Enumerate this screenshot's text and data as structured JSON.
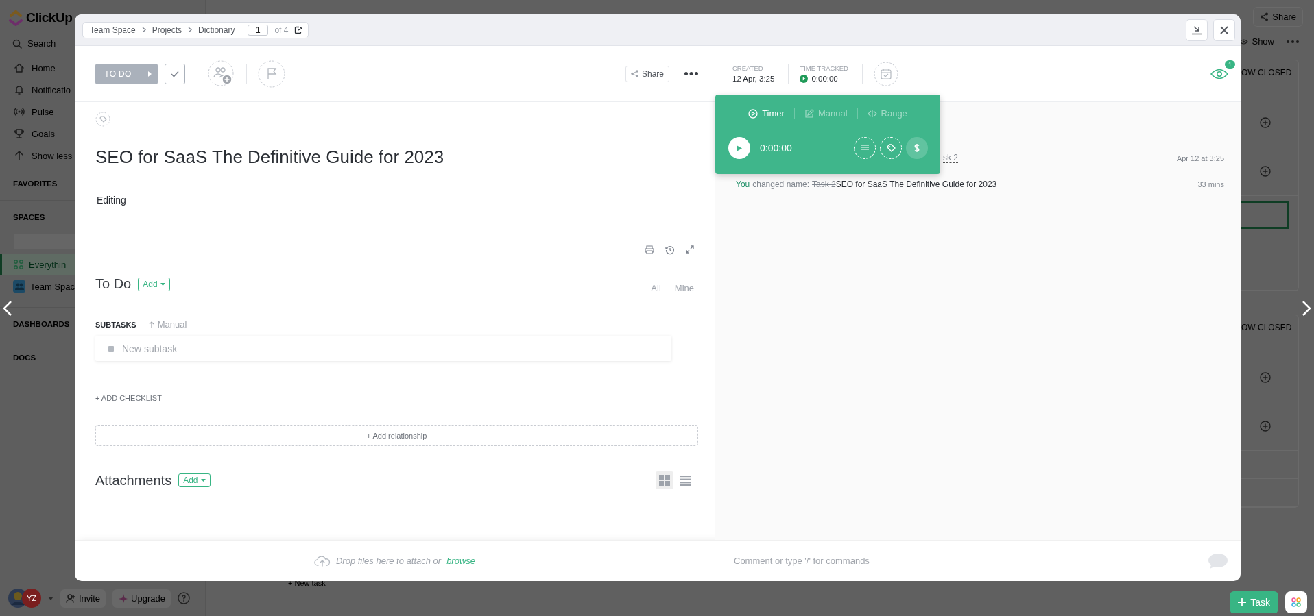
{
  "sidebar": {
    "logo": "ClickUp",
    "search": {
      "placeholder": "Search"
    },
    "nav": [
      {
        "label": "Home"
      },
      {
        "label": "Notificatio"
      },
      {
        "label": "Pulse"
      },
      {
        "label": "Goals"
      },
      {
        "label": "Show less"
      }
    ],
    "sections": [
      {
        "title": "FAVORITES"
      },
      {
        "title": "SPACES",
        "items": [
          {
            "label": "Everythin",
            "selected": true
          },
          {
            "label": "Team Spac",
            "selected": false
          }
        ]
      },
      {
        "title": "DASHBOARDS"
      },
      {
        "title": "DOCS"
      }
    ],
    "footer": {
      "initials": "YZ",
      "invite": "Invite",
      "upgrade": "Upgrade"
    }
  },
  "board": {
    "share": "Share",
    "show": "Show",
    "groups": [
      {
        "label": "OW CLOSED"
      },
      {
        "label": "OW CLOSED"
      }
    ],
    "new_task": "+ New task",
    "task_button": "Task"
  },
  "task": {
    "breadcrumb": [
      "Team Space",
      "Projects",
      "Dictionary"
    ],
    "page": "1",
    "page_total": "of 4",
    "status": "TO DO",
    "share": "Share",
    "title": "SEO for SaaS The Definitive Guide for 2023",
    "description": "Editing",
    "todo": {
      "title": "To Do",
      "add": "Add",
      "filters": [
        {
          "label": "All"
        },
        {
          "label": "Mine"
        }
      ]
    },
    "subtasks": {
      "title": "SUBTASKS",
      "sort": "Manual",
      "placeholder": "New subtask"
    },
    "add_checklist": "+ ADD CHECKLIST",
    "add_relationship": "+ Add relationship",
    "attachments": {
      "title": "Attachments",
      "add": "Add",
      "views": [
        {
          "selected": true
        },
        {
          "selected": false
        }
      ]
    },
    "dropzone": {
      "text": "Drop files here to attach or",
      "link": "browse"
    }
  },
  "details": {
    "created_label": "CREATED",
    "created": "12 Apr, 3:25",
    "tracked_label": "TIME TRACKED",
    "tracked": "0:00:00",
    "watchers": "1"
  },
  "timer": {
    "tabs": [
      {
        "label": "Timer",
        "selected": true
      },
      {
        "label": "Manual",
        "selected": false
      },
      {
        "label": "Range",
        "selected": false
      }
    ],
    "time": "0:00:00"
  },
  "activity": [
    {
      "kind": "partial",
      "text": "sk 2",
      "time": "Apr 12 at 3:25"
    },
    {
      "kind": "rename",
      "actor": "You",
      "action": "changed name:",
      "old": "Task 2",
      "new": "SEO for SaaS The Definitive Guide for 2023",
      "time": "33 mins"
    }
  ],
  "comment": {
    "placeholder": "Comment or type '/' for commands"
  }
}
